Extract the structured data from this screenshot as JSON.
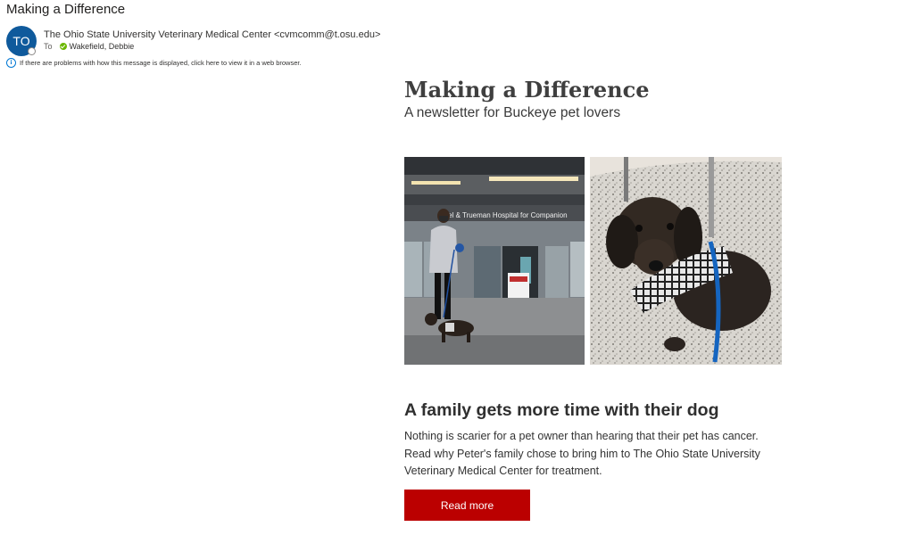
{
  "email": {
    "subject": "Making a Difference",
    "avatar_initials": "TO",
    "sender": "The Ohio State University Veterinary Medical Center <cvmcomm@t.osu.edu>",
    "to_label": "To",
    "recipient": "Wakefield, Debbie",
    "info_message": "If there are problems with how this message is displayed, click here to view it in a web browser."
  },
  "newsletter": {
    "title": "Making a Difference",
    "subtitle": "A newsletter for Buckeye pet lovers",
    "photo1_sign_text": "muel & Trueman Hospital for Companion",
    "article": {
      "title": "A family gets more time with their dog",
      "body": "Nothing is scarier for a pet owner than hearing that their pet has cancer. Read why Peter's family chose to bring him to The Ohio State University Veterinary Medical Center for treatment.",
      "cta": "Read more"
    }
  },
  "colors": {
    "avatar": "#0f5a9c",
    "cta_background": "#bb0000",
    "presence_available": "#6bb700",
    "info_icon": "#0078d4"
  },
  "icons": [
    "info-icon",
    "presence-available-icon"
  ]
}
